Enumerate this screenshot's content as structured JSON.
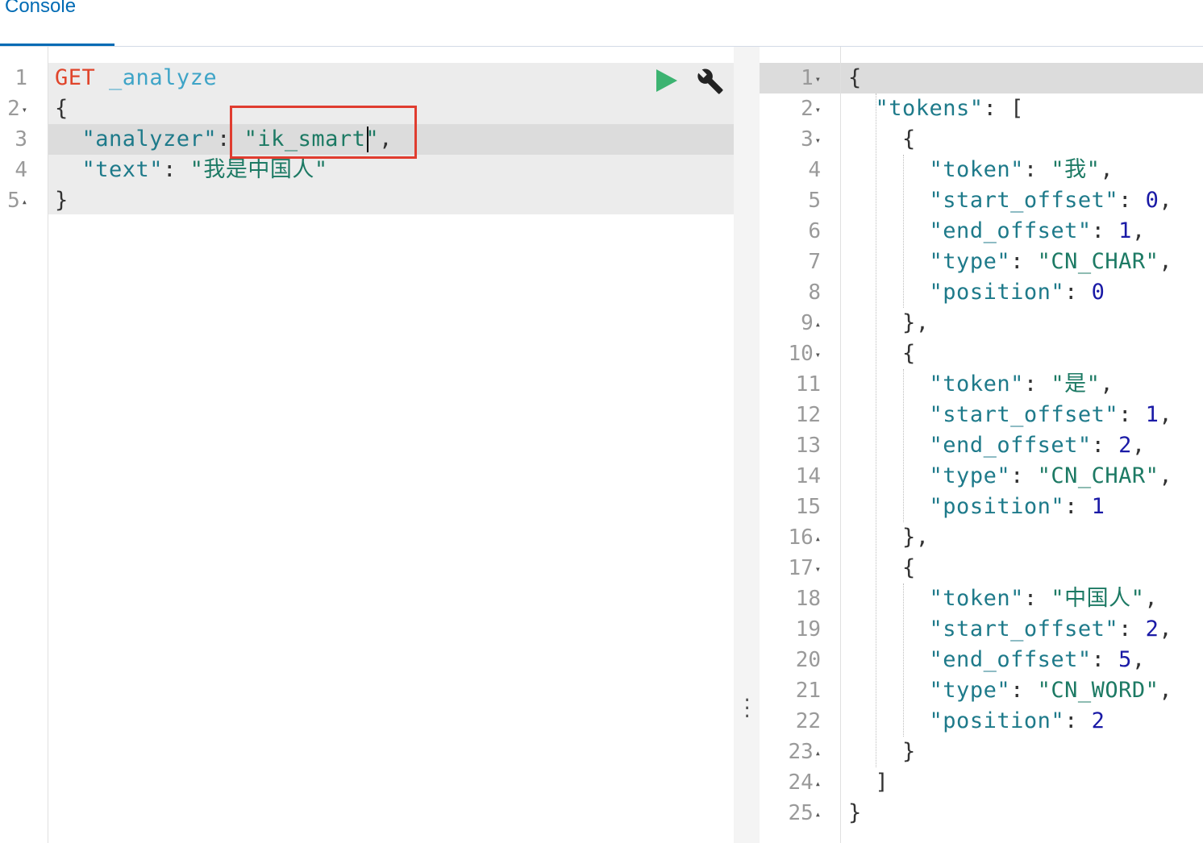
{
  "tab": {
    "label": "Console"
  },
  "request": {
    "line_numbers": [
      "1",
      "2",
      "3",
      "4",
      "5"
    ],
    "method": "GET",
    "endpoint": "_analyze",
    "open_brace": "{",
    "analyzer_key": "\"analyzer\"",
    "analyzer_value": "\"ik_smart\"",
    "text_key": "\"text\"",
    "text_value": "\"我是中国人\"",
    "close_brace": "}"
  },
  "toolbar": {
    "run_icon": "play-icon",
    "settings_icon": "wrench-icon",
    "run_color": "#3cb371"
  },
  "response": {
    "line_numbers": [
      "1",
      "2",
      "3",
      "4",
      "5",
      "6",
      "7",
      "8",
      "9",
      "10",
      "11",
      "12",
      "13",
      "14",
      "15",
      "16",
      "17",
      "18",
      "19",
      "20",
      "21",
      "22",
      "23",
      "24",
      "25"
    ],
    "tokens_key": "\"tokens\"",
    "tokens": [
      {
        "token": "\"我\"",
        "start_offset": "0",
        "end_offset": "1",
        "type": "\"CN_CHAR\"",
        "position": "0"
      },
      {
        "token": "\"是\"",
        "start_offset": "1",
        "end_offset": "2",
        "type": "\"CN_CHAR\"",
        "position": "1"
      },
      {
        "token": "\"中国人\"",
        "start_offset": "2",
        "end_offset": "5",
        "type": "\"CN_WORD\"",
        "position": "2"
      }
    ],
    "keys": {
      "token": "\"token\"",
      "start_offset": "\"start_offset\"",
      "end_offset": "\"end_offset\"",
      "type": "\"type\"",
      "position": "\"position\""
    }
  },
  "colors": {
    "highlight_box": "#e03c2f",
    "tab_accent": "#006bb4"
  }
}
